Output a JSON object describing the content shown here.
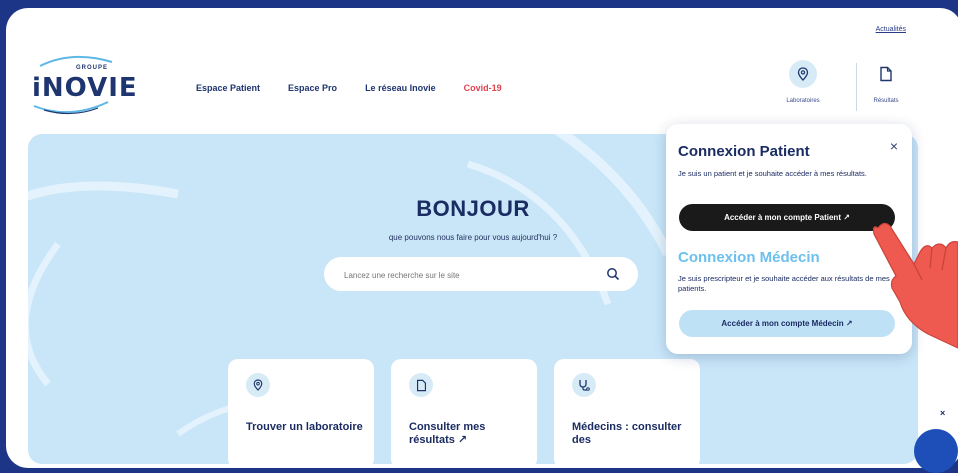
{
  "header": {
    "top_link": "Actualités",
    "logo_word": "iNOVIE",
    "logo_tag": "GROUPE",
    "nav": [
      "Espace Patient",
      "Espace Pro",
      "Le réseau Inovie",
      "Covid-19"
    ],
    "laboratoires_label": "Laboratoires",
    "resultats_label": "Résultats"
  },
  "hero": {
    "title": "BONJOUR",
    "subtitle": "que pouvons nous faire pour vous aujourd'hui ?",
    "search_placeholder": "Lancez une recherche sur le site"
  },
  "cards": [
    {
      "title": "Trouver un laboratoire",
      "icon": "location-pin-icon"
    },
    {
      "title": "Consulter mes résultats ↗",
      "icon": "document-icon"
    },
    {
      "title": "Médecins : consulter des",
      "icon": "stethoscope-icon"
    }
  ],
  "popup": {
    "patient_title": "Connexion Patient",
    "patient_text": "Je suis un patient et je souhaite accéder à mes résultats.",
    "patient_button": "Accéder à mon compte Patient ↗",
    "medecin_title": "Connexion Médecin",
    "medecin_text": "Je suis prescripteur et je souhaite accéder aux résultats de mes patients.",
    "medecin_button": "Accéder à mon compte Médecin ↗",
    "close": "×"
  },
  "side_close": "×",
  "colors": {
    "brand_dark": "#1d3587",
    "hero_bg": "#c9e6f9",
    "covid_red": "#e2424f",
    "accent_light": "#6cc0ed"
  }
}
